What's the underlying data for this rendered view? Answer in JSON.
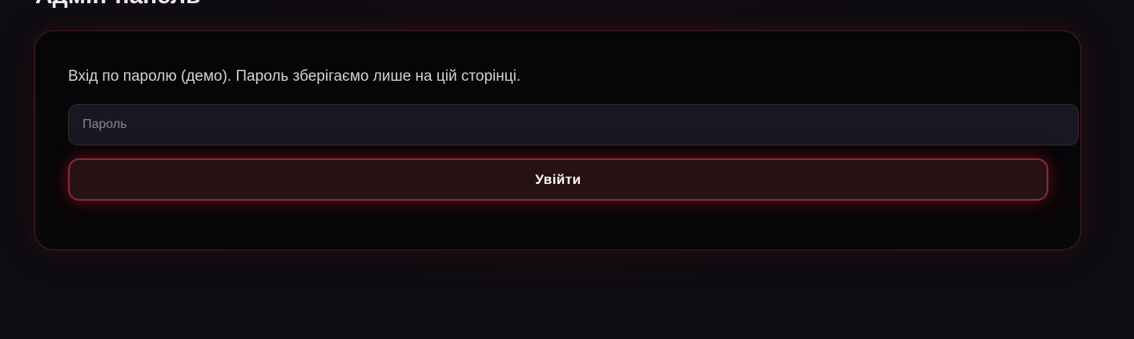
{
  "header": {
    "title": "Адмін-панель"
  },
  "login_card": {
    "hint": "Вхід по паролю (демо). Пароль зберігаємо лише на цій сторінці.",
    "password_placeholder": "Пароль",
    "password_value": "",
    "submit_label": "Увійти"
  },
  "colors": {
    "background": "#0e0d12",
    "card_border": "#4a1d25",
    "input_background": "#171822",
    "button_border": "#8e2a31",
    "button_background": "#261214"
  }
}
